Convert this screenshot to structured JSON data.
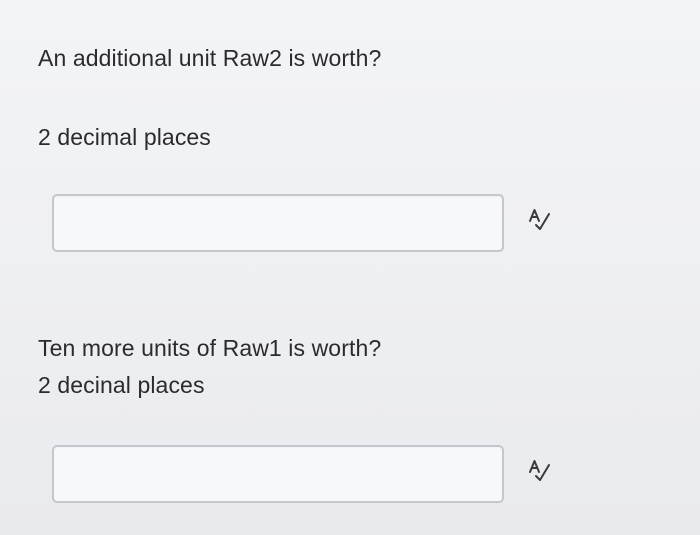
{
  "question1": {
    "prompt": "An additional unit Raw2 is worth?",
    "hint": "2 decimal places",
    "answer_value": "",
    "icon": "spellcheck-icon"
  },
  "question2": {
    "prompt": "Ten more units of Raw1 is worth?",
    "hint": "2 decinal places",
    "answer_value": "",
    "icon": "spellcheck-icon"
  }
}
